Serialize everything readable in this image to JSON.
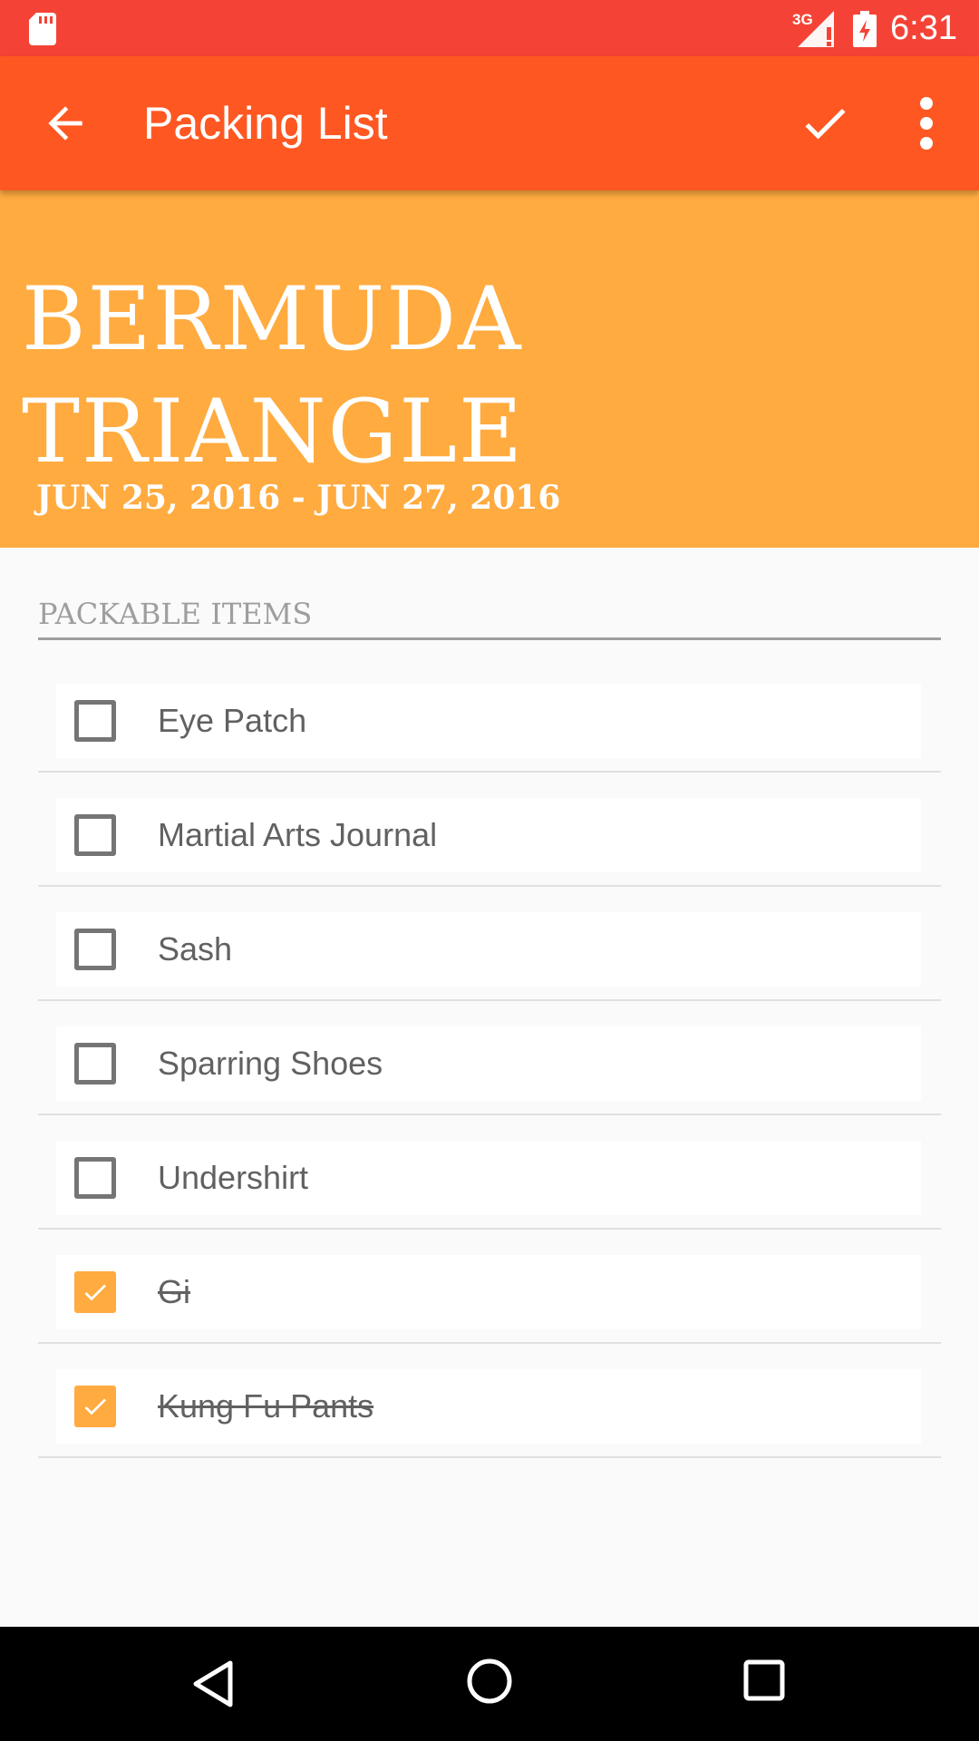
{
  "status_bar": {
    "network": "3G",
    "time": "6:31",
    "icons": [
      "sd-card-icon",
      "signal-icon",
      "battery-icon"
    ]
  },
  "app_bar": {
    "title": "Packing List",
    "icons": [
      "back-arrow-icon",
      "checkmark-icon",
      "more-vert-icon"
    ]
  },
  "trip": {
    "destination": "Bermuda Triangle",
    "dates": "Jun 25, 2016 - Jun 27, 2016"
  },
  "section": {
    "title": "Packable Items"
  },
  "items": [
    {
      "label": "Eye Patch",
      "checked": false
    },
    {
      "label": "Martial Arts Journal",
      "checked": false
    },
    {
      "label": "Sash",
      "checked": false
    },
    {
      "label": "Sparring Shoes",
      "checked": false
    },
    {
      "label": "Undershirt",
      "checked": false
    },
    {
      "label": "Gi",
      "checked": true
    },
    {
      "label": "Kung Fu Pants",
      "checked": true
    }
  ],
  "colors": {
    "status_bar": "#f44336",
    "app_bar": "#ff5722",
    "accent": "#ffab40",
    "background": "#fafafa"
  },
  "nav_bar": {
    "icons": [
      "nav-back-icon",
      "nav-home-icon",
      "nav-recents-icon"
    ]
  }
}
